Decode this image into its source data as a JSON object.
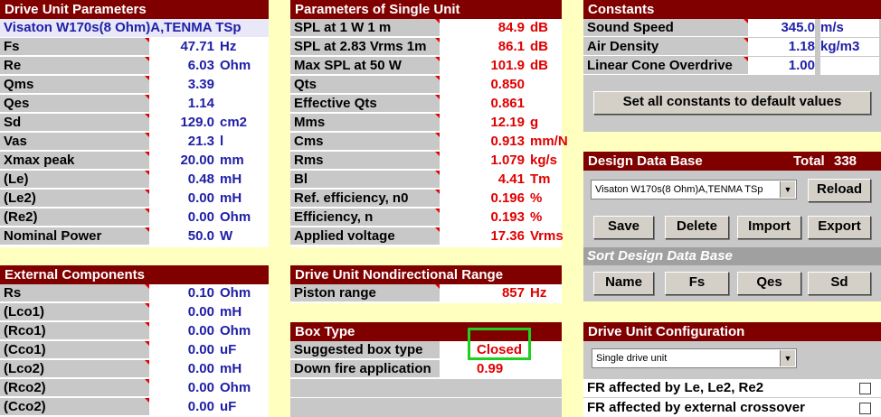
{
  "drive_unit": {
    "title": "Drive Unit Parameters",
    "driver_name": "Visaton W170s(8 Ohm)A,TENMA TSp",
    "rows": [
      {
        "label": "Fs",
        "value": "47.71",
        "unit": "Hz"
      },
      {
        "label": "Re",
        "value": "6.03",
        "unit": "Ohm"
      },
      {
        "label": "Qms",
        "value": "3.39",
        "unit": ""
      },
      {
        "label": "Qes",
        "value": "1.14",
        "unit": ""
      },
      {
        "label": "Sd",
        "value": "129.0",
        "unit": "cm2"
      },
      {
        "label": "Vas",
        "value": "21.3",
        "unit": "l"
      },
      {
        "label": "Xmax peak",
        "value": "20.00",
        "unit": "mm"
      },
      {
        "label": "(Le)",
        "value": "0.48",
        "unit": "mH"
      },
      {
        "label": "(Le2)",
        "value": "0.00",
        "unit": "mH"
      },
      {
        "label": "(Re2)",
        "value": "0.00",
        "unit": "Ohm"
      },
      {
        "label": "Nominal Power",
        "value": "50.0",
        "unit": "W"
      }
    ]
  },
  "external": {
    "title": "External Components",
    "rows": [
      {
        "label": "Rs",
        "value": "0.10",
        "unit": "Ohm"
      },
      {
        "label": "(Lco1)",
        "value": "0.00",
        "unit": "mH"
      },
      {
        "label": "(Rco1)",
        "value": "0.00",
        "unit": "Ohm"
      },
      {
        "label": "(Cco1)",
        "value": "0.00",
        "unit": "uF"
      },
      {
        "label": "(Lco2)",
        "value": "0.00",
        "unit": "mH"
      },
      {
        "label": "(Rco2)",
        "value": "0.00",
        "unit": "Ohm"
      },
      {
        "label": "(Cco2)",
        "value": "0.00",
        "unit": "uF"
      }
    ]
  },
  "single_unit": {
    "title": "Parameters of Single Unit",
    "rows": [
      {
        "label": "SPL at 1 W 1 m",
        "value": "84.9",
        "unit": "dB"
      },
      {
        "label": "SPL at 2.83 Vrms 1m",
        "value": "86.1",
        "unit": "dB"
      },
      {
        "label": "Max SPL at 50 W",
        "value": "101.9",
        "unit": "dB"
      },
      {
        "label": "Qts",
        "value": "0.850",
        "unit": ""
      },
      {
        "label": "Effective Qts",
        "value": "0.861",
        "unit": ""
      },
      {
        "label": "Mms",
        "value": "12.19",
        "unit": "g"
      },
      {
        "label": "Cms",
        "value": "0.913",
        "unit": "mm/N"
      },
      {
        "label": "Rms",
        "value": "1.079",
        "unit": "kg/s"
      },
      {
        "label": "Bl",
        "value": "4.41",
        "unit": "Tm"
      },
      {
        "label": "Ref. efficiency, n0",
        "value": "0.196",
        "unit": "%"
      },
      {
        "label": "Efficiency, n",
        "value": "0.193",
        "unit": "%"
      },
      {
        "label": "Applied voltage",
        "value": "17.36",
        "unit": "Vrms"
      }
    ]
  },
  "nondirectional": {
    "title": "Drive Unit Nondirectional Range",
    "rows": [
      {
        "label": "Piston range",
        "value": "857",
        "unit": "Hz"
      }
    ]
  },
  "box_type": {
    "title": "Box Type",
    "suggested_label": "Suggested box type",
    "suggested_value": "Closed",
    "downfire_label": "Down fire application",
    "downfire_value": "0.99"
  },
  "constants": {
    "title": "Constants",
    "rows": [
      {
        "label": "Sound Speed",
        "value": "345.0",
        "unit": "m/s"
      },
      {
        "label": "Air Density",
        "value": "1.18",
        "unit": "kg/m3"
      },
      {
        "label": "Linear Cone Overdrive",
        "value": "1.00",
        "unit": ""
      }
    ],
    "default_button": "Set all constants to default values"
  },
  "database": {
    "title": "Design Data Base",
    "total_label": "Total",
    "total_value": "338",
    "selected": "Visaton W170s(8 Ohm)A,TENMA TSp",
    "reload": "Reload",
    "save": "Save",
    "delete": "Delete",
    "import": "Import",
    "export": "Export",
    "sort_title": "Sort Design Data Base",
    "sort_buttons": [
      "Name",
      "Fs",
      "Qes",
      "Sd"
    ]
  },
  "configuration": {
    "title": "Drive Unit Configuration",
    "selected": "Single drive unit",
    "fr_le": "FR affected by Le, Le2, Re2",
    "fr_crossover": "FR affected by external crossover"
  },
  "colors": {
    "header": "#800000",
    "label_bg": "#c8c8c8",
    "value_blue": "#2020a8",
    "value_red": "#e00000",
    "background": "#ffffc0",
    "highlight": "#20d020"
  }
}
